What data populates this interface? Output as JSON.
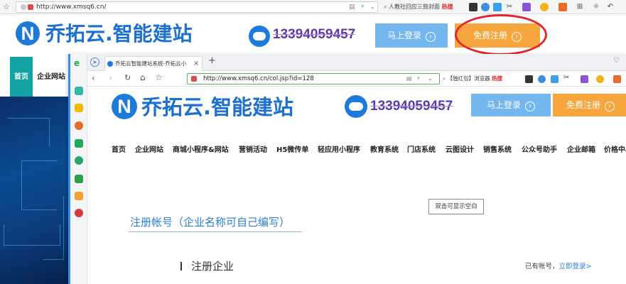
{
  "bg_browser": {
    "url": "http://www.xmsq6.cn/",
    "search_text": "人教社回应三鼓封面",
    "search_tag": "热搜"
  },
  "bg_site": {
    "logo_letter": "N",
    "logo_text": "乔拓云.智能建站",
    "phone": "13394059457",
    "login_label": "马上登录",
    "register_label": "免费注册",
    "arrow": "›",
    "nav_home": "首页",
    "nav_corp": "企业网站"
  },
  "fg_browser": {
    "tab_title": "乔拓云智能建站系统-乔拓云小",
    "tab_close": "×",
    "new_tab": "+",
    "url": "http://www.xmsq6.cn/col.jsp?id=128",
    "search_text": "【独红包】浏览器",
    "search_tag": "热搜"
  },
  "fg_site": {
    "logo_letter": "N",
    "logo_text": "乔拓云.智能建站",
    "phone": "13394059457",
    "login_label": "马上登录",
    "register_label": "免费注册",
    "arrow": "›",
    "nav": [
      "首页",
      "企业网站",
      "商城小程序&网站",
      "营销活动",
      "H5微传单",
      "轻应用小程序",
      "教育系统",
      "门店系统",
      "云图设计",
      "销售系统",
      "公众号助手",
      "企业邮箱",
      "价格中心"
    ],
    "tooltip": "双击可显示空白",
    "register_title": "注册帐号（企业名称可自己编写）",
    "register_company": "注册企业",
    "have_account": "已有帐号，",
    "login_link": "立即登录>"
  },
  "colors": {
    "brand_blue": "#1d6fd0",
    "login_btn": "#74b6ee",
    "register_btn": "#f6a63d",
    "highlight_circle": "#e2262a",
    "nav_active": "#13a3a3",
    "phone_purple": "#5c3aa8"
  }
}
